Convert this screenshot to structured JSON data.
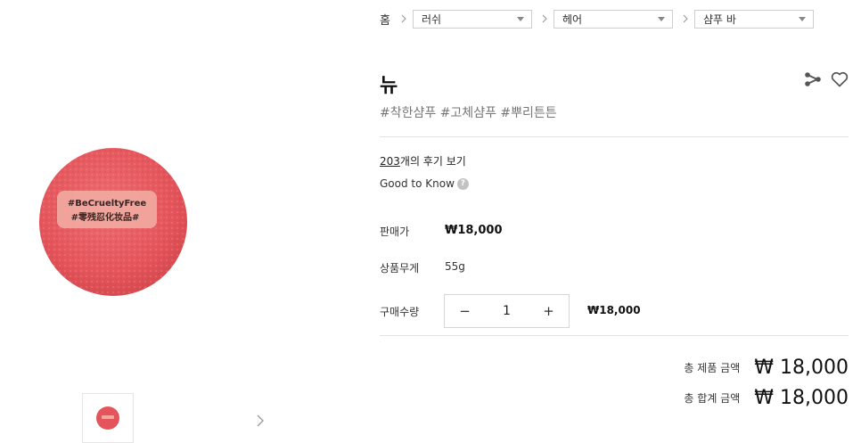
{
  "breadcrumb": {
    "home": "홈",
    "levels": [
      "러쉬",
      "헤어",
      "샴푸 바"
    ]
  },
  "product": {
    "name": "뉴",
    "hashtags": "#착한샴푸 #고체샴푸 #뿌리튼튼",
    "image_label_line1": "#BeCrueltyFree",
    "image_label_line2": "#零残忍化妆品#"
  },
  "reviews": {
    "count": "203",
    "suffix": "개의 후기 보기"
  },
  "good_to_know": {
    "label": "Good to Know",
    "icon": "question-icon"
  },
  "price": {
    "label": "판매가",
    "value": "₩18,000"
  },
  "weight": {
    "label": "상품무게",
    "value": "55g"
  },
  "quantity": {
    "label": "구매수량",
    "minus": "−",
    "plus": "+",
    "value": "1",
    "line_price": "₩18,000"
  },
  "totals": {
    "product_total_label": "총 제품 금액",
    "product_total_value": "₩ 18,000",
    "grand_total_label": "총 합계 금액",
    "grand_total_value": "₩ 18,000"
  },
  "icons": {
    "share": "share-icon",
    "wishlist": "heart-icon",
    "thumb_next": "chevron-right-icon"
  },
  "colors": {
    "product_pink": "#e8565c",
    "label_peach": "#f3b3a8"
  }
}
